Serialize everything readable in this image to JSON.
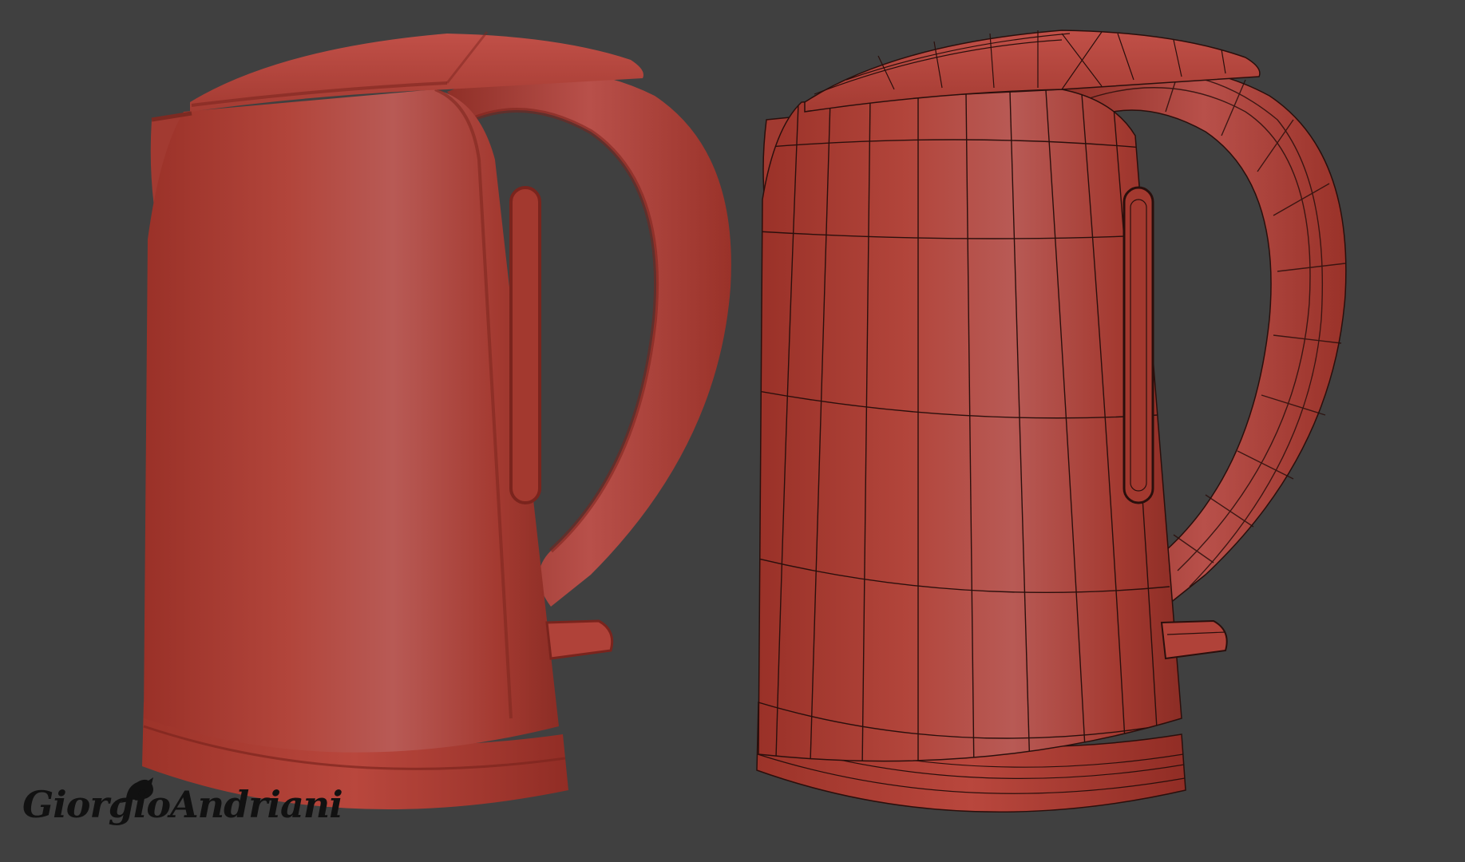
{
  "render": {
    "background": "#404040",
    "kettle_color": "#b6443a",
    "wire_color": "#2a0f0c"
  },
  "views": [
    {
      "name": "smooth-kettle",
      "shading": "smooth"
    },
    {
      "name": "wireframe-kettle",
      "shading": "wireframe-on-shaded"
    }
  ],
  "signature": {
    "text": "GiorgioAndriani",
    "icon": "bird-icon"
  }
}
